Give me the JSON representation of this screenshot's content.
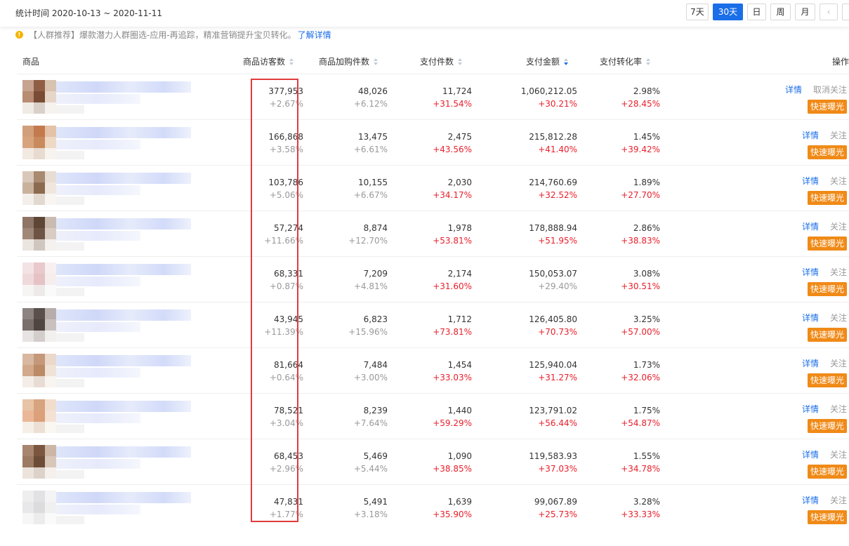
{
  "header": {
    "stat_time": "统计时间 2020-10-13 ~ 2020-11-11",
    "range_buttons": [
      "7天",
      "30天",
      "日",
      "周",
      "月"
    ],
    "active_range": "30天",
    "prev_glyph": "‹",
    "next_glyph": "›"
  },
  "notice": {
    "icon": "warning-icon",
    "text": "【人群推荐】爆款潜力人群圈选-应用-再追踪，精准营销提升宝贝转化。",
    "link": "了解详情"
  },
  "table": {
    "columns": [
      "商品",
      "商品访客数",
      "商品加购件数",
      "支付件数",
      "支付金额",
      "支付转化率",
      "操作"
    ],
    "sorted_column": "支付金额",
    "ops_labels": {
      "detail": "详情",
      "follow": "关注",
      "unfollow": "取消关注",
      "quick": "快速曝光"
    },
    "rows": [
      {
        "visitors": "377,953",
        "visitors_delta": "+2.67%",
        "cart": "48,026",
        "cart_delta": "+6.12%",
        "pay_count": "11,724",
        "pay_count_delta": "+31.54%",
        "pay_amount": "1,060,212.05",
        "pay_amount_delta": "+30.21%",
        "conv": "2.98%",
        "conv_delta": "+28.45%",
        "follow": "取消关注"
      },
      {
        "visitors": "166,868",
        "visitors_delta": "+3.58%",
        "cart": "13,475",
        "cart_delta": "+6.61%",
        "pay_count": "2,475",
        "pay_count_delta": "+43.56%",
        "pay_amount": "215,812.28",
        "pay_amount_delta": "+41.40%",
        "conv": "1.45%",
        "conv_delta": "+39.42%",
        "follow": "关注"
      },
      {
        "visitors": "103,786",
        "visitors_delta": "+5.06%",
        "cart": "10,155",
        "cart_delta": "+6.67%",
        "pay_count": "2,030",
        "pay_count_delta": "+34.17%",
        "pay_amount": "214,760.69",
        "pay_amount_delta": "+32.52%",
        "conv": "1.89%",
        "conv_delta": "+27.70%",
        "follow": "关注"
      },
      {
        "visitors": "57,274",
        "visitors_delta": "+11.66%",
        "cart": "8,874",
        "cart_delta": "+12.70%",
        "pay_count": "1,978",
        "pay_count_delta": "+53.81%",
        "pay_amount": "178,888.94",
        "pay_amount_delta": "+51.95%",
        "conv": "2.86%",
        "conv_delta": "+38.83%",
        "follow": "关注"
      },
      {
        "visitors": "68,331",
        "visitors_delta": "+0.87%",
        "cart": "7,209",
        "cart_delta": "+4.81%",
        "pay_count": "2,174",
        "pay_count_delta": "+31.60%",
        "pay_amount": "150,053.07",
        "pay_amount_delta": "+29.40%",
        "conv": "3.08%",
        "conv_delta": "+30.51%",
        "follow": "关注"
      },
      {
        "visitors": "43,945",
        "visitors_delta": "+11.39%",
        "cart": "6,823",
        "cart_delta": "+15.96%",
        "pay_count": "1,712",
        "pay_count_delta": "+73.81%",
        "pay_amount": "126,405.80",
        "pay_amount_delta": "+70.73%",
        "conv": "3.25%",
        "conv_delta": "+57.00%",
        "follow": "关注"
      },
      {
        "visitors": "81,664",
        "visitors_delta": "+0.64%",
        "cart": "7,484",
        "cart_delta": "+3.00%",
        "pay_count": "1,454",
        "pay_count_delta": "+33.03%",
        "pay_amount": "125,940.04",
        "pay_amount_delta": "+31.27%",
        "conv": "1.73%",
        "conv_delta": "+32.06%",
        "follow": "关注"
      },
      {
        "visitors": "78,521",
        "visitors_delta": "+3.04%",
        "cart": "8,239",
        "cart_delta": "+7.64%",
        "pay_count": "1,440",
        "pay_count_delta": "+59.29%",
        "pay_amount": "123,791.02",
        "pay_amount_delta": "+56.44%",
        "conv": "1.75%",
        "conv_delta": "+54.87%",
        "follow": "关注"
      },
      {
        "visitors": "68,453",
        "visitors_delta": "+2.96%",
        "cart": "5,469",
        "cart_delta": "+5.44%",
        "pay_count": "1,090",
        "pay_count_delta": "+38.85%",
        "pay_amount": "119,583.93",
        "pay_amount_delta": "+37.03%",
        "conv": "1.55%",
        "conv_delta": "+34.78%",
        "follow": "关注"
      },
      {
        "visitors": "47,831",
        "visitors_delta": "+1.77%",
        "cart": "5,491",
        "cart_delta": "+3.18%",
        "pay_count": "1,639",
        "pay_count_delta": "+35.90%",
        "pay_amount": "99,067.89",
        "pay_amount_delta": "+25.73%",
        "conv": "3.28%",
        "conv_delta": "+33.33%",
        "follow": "关注"
      }
    ]
  },
  "colors": {
    "accent": "#1a6ee8",
    "increase_red": "#e8202c",
    "quick_button": "#f08a17",
    "highlight_box": "#e23b3b"
  }
}
